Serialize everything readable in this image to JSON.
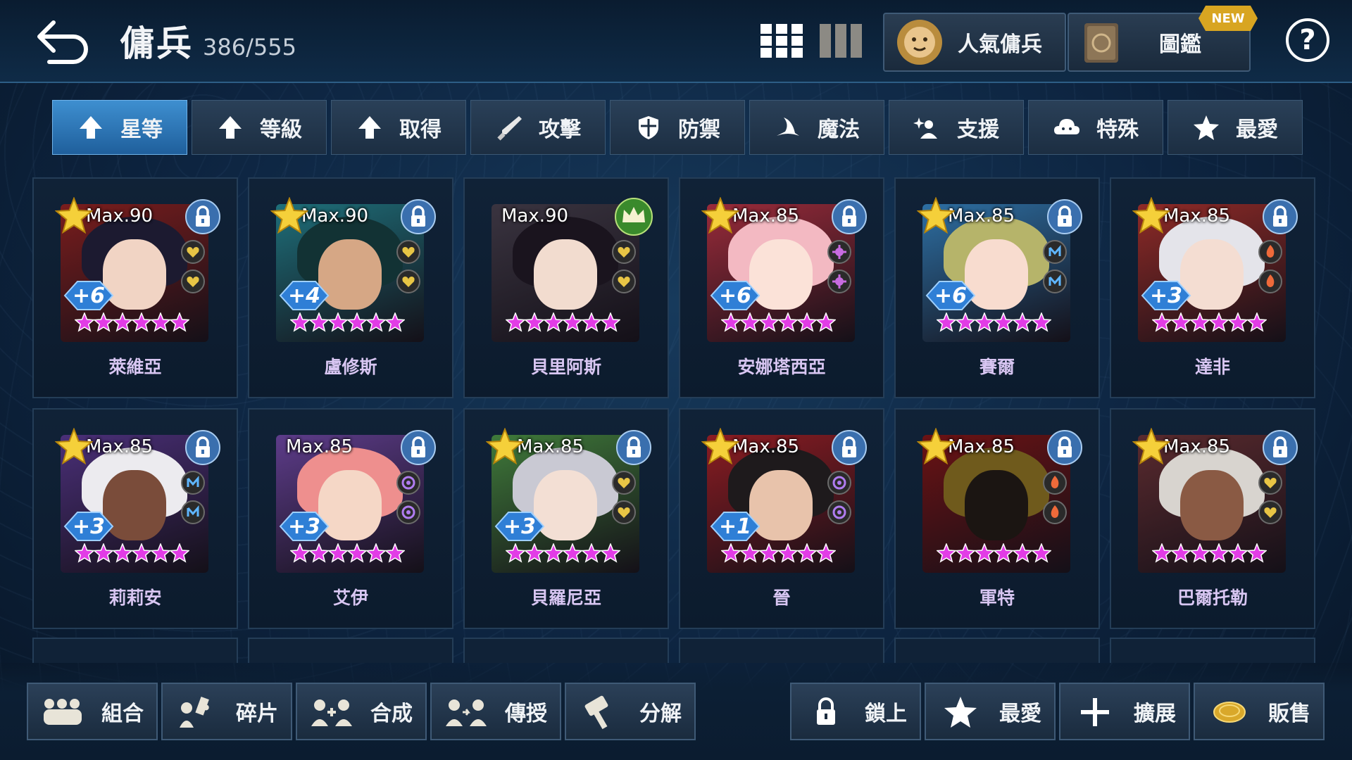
{
  "header": {
    "title": "傭兵",
    "count": "386/555"
  },
  "top_buttons": [
    {
      "label": "人氣傭兵",
      "icon": "lion-emblem-icon"
    },
    {
      "label": "圖鑑",
      "icon": "book-icon",
      "badge": "NEW"
    }
  ],
  "help_label": "?",
  "sort_tabs": [
    {
      "label": "星等",
      "icon": "arrow-up-icon",
      "active": true
    },
    {
      "label": "等級",
      "icon": "arrow-up-icon"
    },
    {
      "label": "取得",
      "icon": "arrow-up-icon"
    },
    {
      "label": "攻擊",
      "icon": "sword-icon"
    },
    {
      "label": "防禦",
      "icon": "shield-icon"
    },
    {
      "label": "魔法",
      "icon": "wizard-hat-icon"
    },
    {
      "label": "支援",
      "icon": "sparkle-person-icon"
    },
    {
      "label": "特殊",
      "icon": "cloud-icon"
    },
    {
      "label": "最愛",
      "icon": "star-icon"
    }
  ],
  "mercenaries": [
    {
      "name": "萊維亞",
      "level_label": "Max.90",
      "plus": "+6",
      "crowned": false,
      "gem": "gold-heart",
      "bg": "#7a1d1d",
      "hair": "#1c1a30",
      "skin": "#f1d4c4"
    },
    {
      "name": "盧修斯",
      "level_label": "Max.90",
      "plus": "+4",
      "crowned": false,
      "gem": "gold-heart",
      "bg": "#1e6f7a",
      "hair": "#123234",
      "skin": "#d6a785"
    },
    {
      "name": "貝里阿斯",
      "level_label": "Max.90",
      "plus": "",
      "crowned": true,
      "gem": "gold-heart",
      "bg": "#3a3440",
      "hair": "#1a141e",
      "skin": "#f2dccf"
    },
    {
      "name": "安娜塔西亞",
      "level_label": "Max.85",
      "plus": "+6",
      "crowned": false,
      "gem": "purple-flower",
      "bg": "#9a2b3a",
      "hair": "#f3b9c2",
      "skin": "#fbe2d8"
    },
    {
      "name": "賽爾",
      "level_label": "Max.85",
      "plus": "+6",
      "crowned": false,
      "gem": "blue-rune",
      "bg": "#2d6fa3",
      "hair": "#b6b46a",
      "skin": "#f8dccf"
    },
    {
      "name": "達非",
      "level_label": "Max.85",
      "plus": "+3",
      "crowned": false,
      "gem": "red-flame",
      "bg": "#8f2a27",
      "hair": "#e4e4ea",
      "skin": "#f4ddd2"
    },
    {
      "name": "莉莉安",
      "level_label": "Max.85",
      "plus": "+3",
      "crowned": false,
      "gem": "blue-rune",
      "bg": "#4a2f78",
      "hair": "#ecebef",
      "skin": "#7a4c3a"
    },
    {
      "name": "艾伊",
      "level_label": "Max.85",
      "plus": "+3",
      "crowned": false,
      "gem": "purple-orb",
      "bg": "#5d3c8a",
      "hair": "#ee8f8e",
      "skin": "#f5d7c6"
    },
    {
      "name": "貝羅尼亞",
      "level_label": "Max.85",
      "plus": "+3",
      "crowned": false,
      "gem": "gold-heart",
      "bg": "#3f7a3a",
      "hair": "#c9c9d3",
      "skin": "#f3dfd4"
    },
    {
      "name": "晉",
      "level_label": "Max.85",
      "plus": "+1",
      "crowned": false,
      "gem": "purple-orb",
      "bg": "#8b1c22",
      "hair": "#1e1a1c",
      "skin": "#e8c3ab"
    },
    {
      "name": "軍特",
      "level_label": "Max.85",
      "plus": "",
      "crowned": false,
      "gem": "red-flame",
      "bg": "#6b1214",
      "hair": "#6f5a1c",
      "skin": "#1b1512"
    },
    {
      "name": "巴爾托勒",
      "level_label": "Max.85",
      "plus": "",
      "crowned": false,
      "gem": "gold-heart",
      "bg": "#5a2a2e",
      "hair": "#d8d4cf",
      "skin": "#8a5a44"
    }
  ],
  "bottom_left": [
    {
      "label": "組合",
      "icon": "group-icon"
    },
    {
      "label": "碎片",
      "icon": "puzzle-icon"
    },
    {
      "label": "合成",
      "icon": "merge-icon"
    },
    {
      "label": "傳授",
      "icon": "transfer-icon"
    },
    {
      "label": "分解",
      "icon": "hammer-icon"
    }
  ],
  "bottom_right": [
    {
      "label": "鎖上",
      "icon": "lock-icon"
    },
    {
      "label": "最愛",
      "icon": "star-icon"
    },
    {
      "label": "擴展",
      "icon": "plus-icon"
    },
    {
      "label": "販售",
      "icon": "coin-icon"
    }
  ],
  "colors": {
    "accent": "#3e8fd0",
    "name_text": "#d8c6f2",
    "star_pink": "#e23ce6",
    "badge_gold": "#d8a521"
  }
}
